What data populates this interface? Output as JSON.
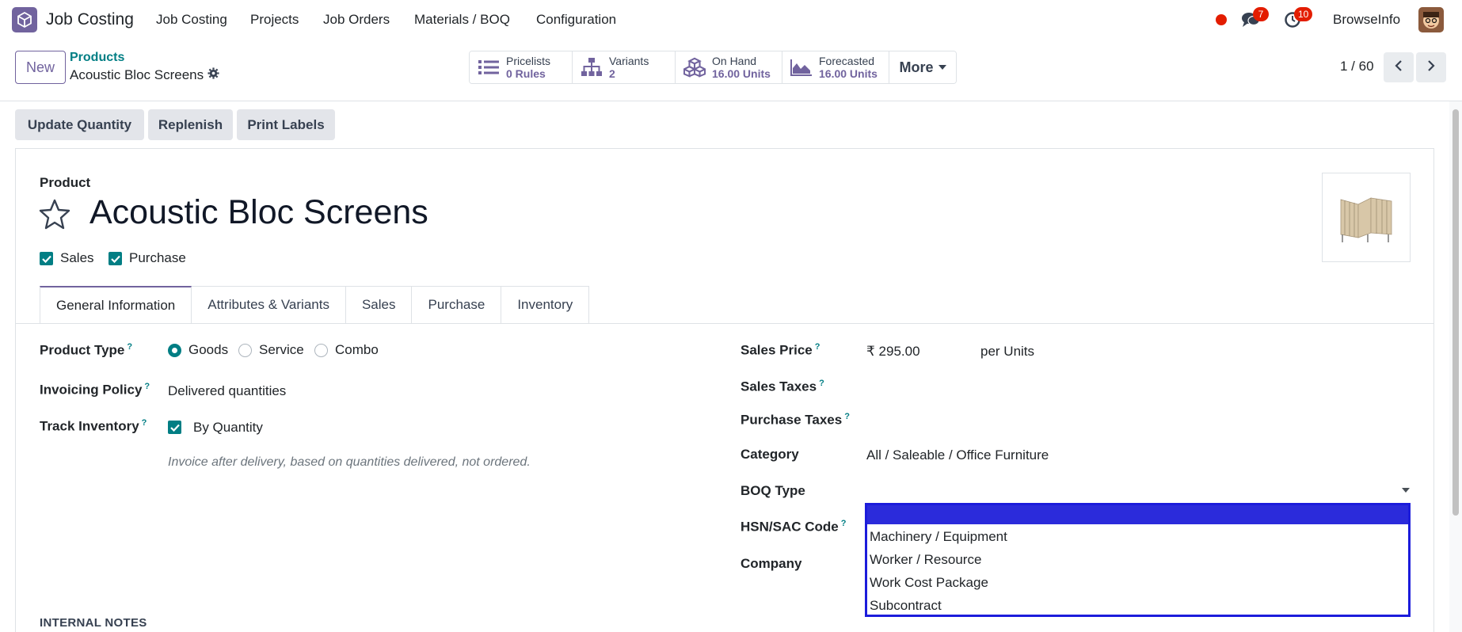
{
  "topnav": {
    "app_name": "Job Costing",
    "menu": [
      "Job Costing",
      "Projects",
      "Job Orders",
      "Materials / BOQ",
      "Configuration"
    ],
    "messages_count": "7",
    "activities_count": "10",
    "user": "BrowseInfo"
  },
  "breadcrumb": {
    "new_label": "New",
    "parent": "Products",
    "current": "Acoustic Bloc Screens"
  },
  "smart_buttons": [
    {
      "icon": "list-icon",
      "label": "Pricelists",
      "value": "0 Rules"
    },
    {
      "icon": "sitemap-icon",
      "label": "Variants",
      "value": "2"
    },
    {
      "icon": "cubes-icon",
      "label": "On Hand",
      "value": "16.00 Units"
    },
    {
      "icon": "area-chart-icon",
      "label": "Forecasted",
      "value": "16.00 Units"
    },
    {
      "icon": "caret-down-icon",
      "label": "More",
      "value": ""
    }
  ],
  "pager": "1 / 60",
  "actions": [
    "Update Quantity",
    "Replenish",
    "Print Labels"
  ],
  "form": {
    "product_label": "Product",
    "name": "Acoustic Bloc Screens",
    "sales_check": "Sales",
    "purchase_check": "Purchase",
    "tabs": [
      "General Information",
      "Attributes & Variants",
      "Sales",
      "Purchase",
      "Inventory"
    ],
    "left": {
      "product_type_label": "Product Type",
      "product_type_options": [
        "Goods",
        "Service",
        "Combo"
      ],
      "invoicing_policy_label": "Invoicing Policy",
      "invoicing_policy_value": "Delivered quantities",
      "track_inventory_label": "Track Inventory",
      "track_inventory_value": "By Quantity",
      "hint": "Invoice after delivery, based on quantities delivered, not ordered."
    },
    "right": {
      "sales_price_label": "Sales Price",
      "sales_price_value": "₹ 295.00",
      "per_unit": "per Units",
      "sales_taxes_label": "Sales Taxes",
      "purchase_taxes_label": "Purchase Taxes",
      "category_label": "Category",
      "category_value": "All / Saleable / Office Furniture",
      "boq_type_label": "BOQ Type",
      "hsn_label": "HSN/SAC Code",
      "company_label": "Company"
    },
    "boq_options": [
      "",
      "Machinery / Equipment",
      "Worker / Resource",
      "Work Cost Package",
      "Subcontract"
    ],
    "internal_notes": "INTERNAL NOTES"
  },
  "colors": {
    "brand": "#71639e",
    "accent": "#017e84",
    "dropdown_highlight": "#2b2bdb"
  }
}
